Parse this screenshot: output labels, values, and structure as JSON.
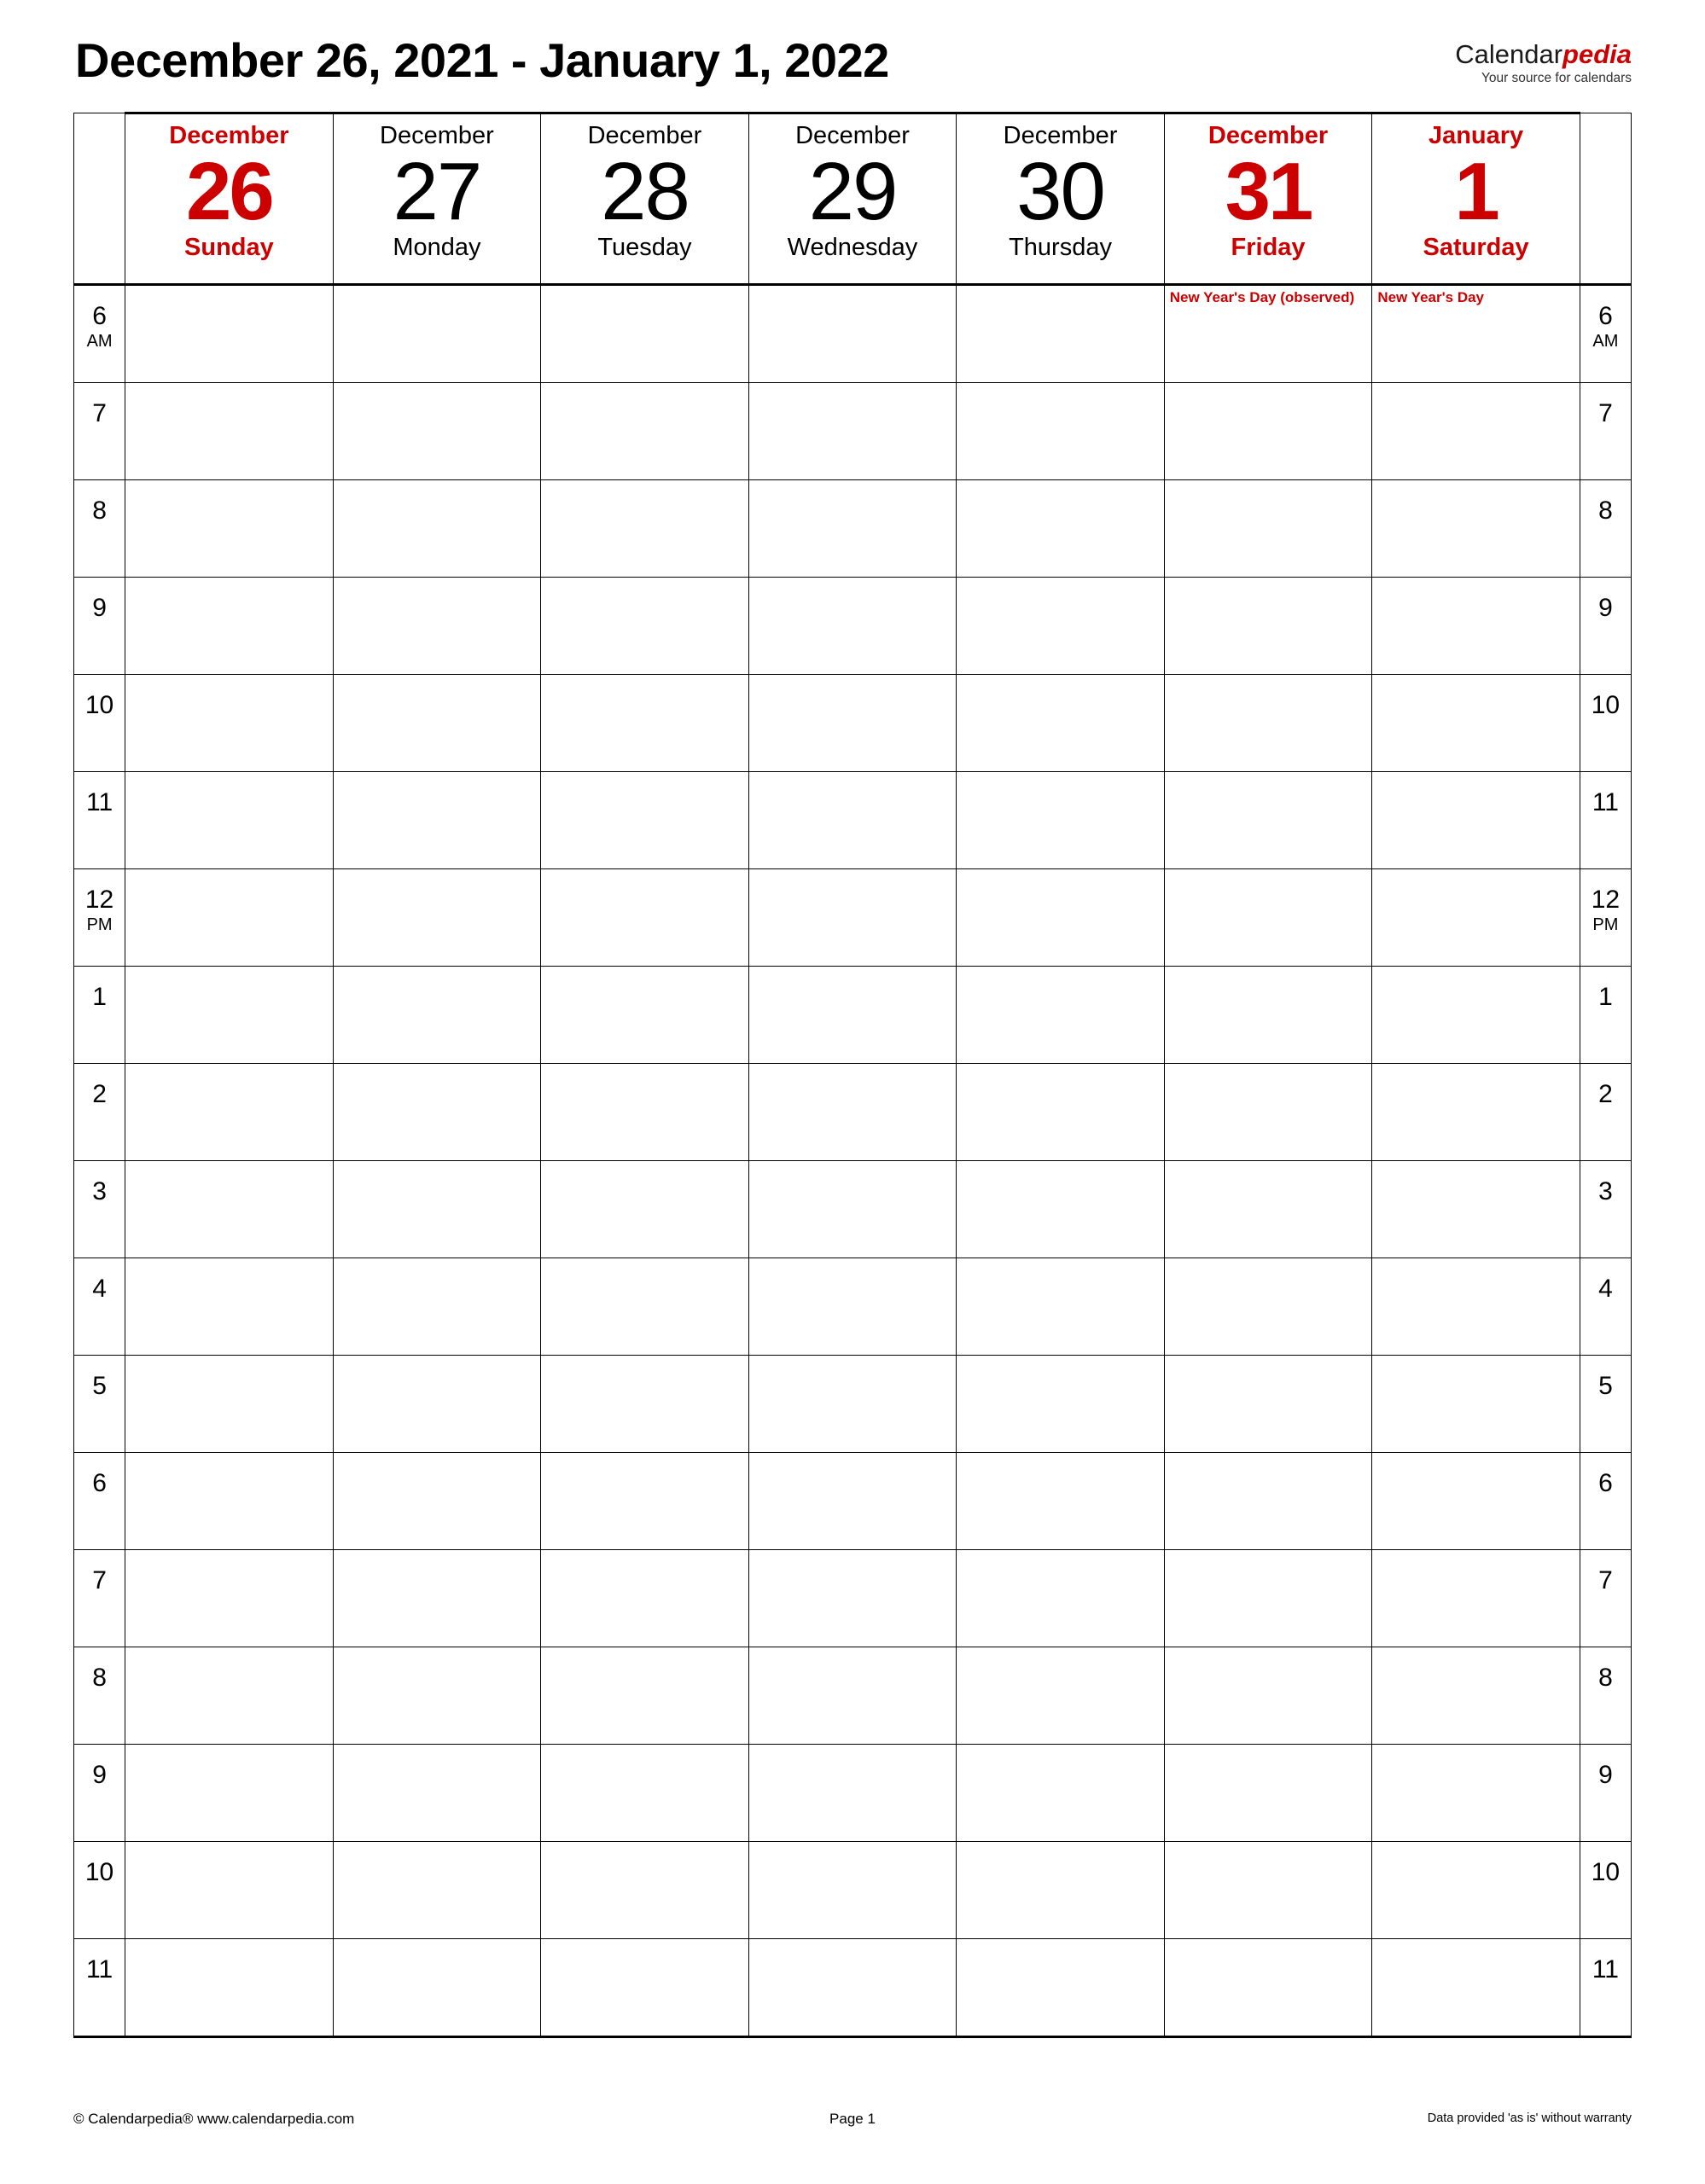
{
  "header": {
    "title": "December 26, 2021 - January 1, 2022",
    "brand_part1": "Calendar",
    "brand_part2": "pedia",
    "brand_tagline": "Your source for calendars"
  },
  "colors": {
    "accent_red": "#cc0000",
    "text": "#000000",
    "grid": "#000000",
    "background": "#ffffff"
  },
  "days": [
    {
      "month": "December",
      "number": "26",
      "weekday": "Sunday",
      "weekend": true,
      "holiday": ""
    },
    {
      "month": "December",
      "number": "27",
      "weekday": "Monday",
      "weekend": false,
      "holiday": ""
    },
    {
      "month": "December",
      "number": "28",
      "weekday": "Tuesday",
      "weekend": false,
      "holiday": ""
    },
    {
      "month": "December",
      "number": "29",
      "weekday": "Wednesday",
      "weekend": false,
      "holiday": ""
    },
    {
      "month": "December",
      "number": "30",
      "weekday": "Thursday",
      "weekend": false,
      "holiday": ""
    },
    {
      "month": "December",
      "number": "31",
      "weekday": "Friday",
      "weekend": true,
      "holiday": "New Year's Day (observed)"
    },
    {
      "month": "January",
      "number": "1",
      "weekday": "Saturday",
      "weekend": true,
      "holiday": "New Year's Day"
    }
  ],
  "hours": [
    {
      "label": "6",
      "ampm": "AM"
    },
    {
      "label": "7",
      "ampm": ""
    },
    {
      "label": "8",
      "ampm": ""
    },
    {
      "label": "9",
      "ampm": ""
    },
    {
      "label": "10",
      "ampm": ""
    },
    {
      "label": "11",
      "ampm": ""
    },
    {
      "label": "12",
      "ampm": "PM"
    },
    {
      "label": "1",
      "ampm": ""
    },
    {
      "label": "2",
      "ampm": ""
    },
    {
      "label": "3",
      "ampm": ""
    },
    {
      "label": "4",
      "ampm": ""
    },
    {
      "label": "5",
      "ampm": ""
    },
    {
      "label": "6",
      "ampm": ""
    },
    {
      "label": "7",
      "ampm": ""
    },
    {
      "label": "8",
      "ampm": ""
    },
    {
      "label": "9",
      "ampm": ""
    },
    {
      "label": "10",
      "ampm": ""
    },
    {
      "label": "11",
      "ampm": ""
    }
  ],
  "footer": {
    "left": "© Calendarpedia®   www.calendarpedia.com",
    "center": "Page 1",
    "right": "Data provided 'as is' without warranty"
  }
}
